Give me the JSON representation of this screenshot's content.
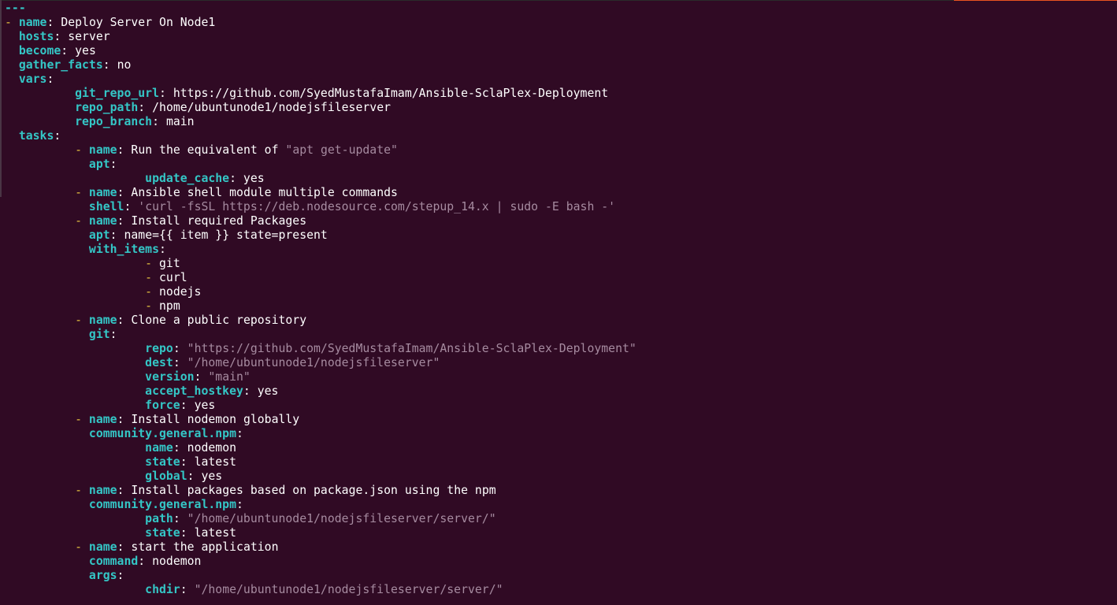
{
  "window": {
    "type": "terminal",
    "accent_color": "#e95420",
    "background_color": "#300a24"
  },
  "editor": {
    "language": "yaml",
    "lines": [
      {
        "indent": "",
        "dash": "",
        "key": "---",
        "value": "",
        "valueType": "doc"
      },
      {
        "indent": "",
        "dash": "- ",
        "key": "name",
        "value": "Deploy Server On Node1",
        "valueType": "plain"
      },
      {
        "indent": "  ",
        "dash": "",
        "key": "hosts",
        "value": "server",
        "valueType": "plain"
      },
      {
        "indent": "  ",
        "dash": "",
        "key": "become",
        "value": "yes",
        "valueType": "plain"
      },
      {
        "indent": "  ",
        "dash": "",
        "key": "gather_facts",
        "value": "no",
        "valueType": "plain"
      },
      {
        "indent": "  ",
        "dash": "",
        "key": "vars",
        "value": "",
        "valueType": "none"
      },
      {
        "indent": "          ",
        "dash": "",
        "key": "git_repo_url",
        "value": "https://github.com/SyedMustafaImam/Ansible-SclaPlex-Deployment",
        "valueType": "plain"
      },
      {
        "indent": "          ",
        "dash": "",
        "key": "repo_path",
        "value": "/home/ubuntunode1/nodejsfileserver",
        "valueType": "plain"
      },
      {
        "indent": "          ",
        "dash": "",
        "key": "repo_branch",
        "value": "main",
        "valueType": "plain"
      },
      {
        "indent": "  ",
        "dash": "",
        "key": "tasks",
        "value": "",
        "valueType": "none"
      },
      {
        "indent": "          ",
        "dash": "- ",
        "key": "name",
        "value": "Run the equivalent of ",
        "valueType": "mixed",
        "string": "\"apt get-update\""
      },
      {
        "indent": "            ",
        "dash": "",
        "key": "apt",
        "value": "",
        "valueType": "none"
      },
      {
        "indent": "                    ",
        "dash": "",
        "key": "update_cache",
        "value": "yes",
        "valueType": "plain"
      },
      {
        "indent": "          ",
        "dash": "- ",
        "key": "name",
        "value": "Ansible shell module multiple commands",
        "valueType": "plain"
      },
      {
        "indent": "            ",
        "dash": "",
        "key": "shell",
        "value": "'curl -fsSL https://deb.nodesource.com/stepup_14.x | sudo -E bash -'",
        "valueType": "string"
      },
      {
        "indent": "          ",
        "dash": "- ",
        "key": "name",
        "value": "Install required Packages",
        "valueType": "plain"
      },
      {
        "indent": "            ",
        "dash": "",
        "key": "apt",
        "value": "name={{ item }} state=present",
        "valueType": "plain"
      },
      {
        "indent": "            ",
        "dash": "",
        "key": "with_items",
        "value": "",
        "valueType": "none"
      },
      {
        "indent": "                    ",
        "dash": "- ",
        "key": "",
        "value": "git",
        "valueType": "item"
      },
      {
        "indent": "                    ",
        "dash": "- ",
        "key": "",
        "value": "curl",
        "valueType": "item"
      },
      {
        "indent": "                    ",
        "dash": "- ",
        "key": "",
        "value": "nodejs",
        "valueType": "item"
      },
      {
        "indent": "                    ",
        "dash": "- ",
        "key": "",
        "value": "npm",
        "valueType": "item"
      },
      {
        "indent": "          ",
        "dash": "- ",
        "key": "name",
        "value": "Clone a public repository",
        "valueType": "plain"
      },
      {
        "indent": "            ",
        "dash": "",
        "key": "git",
        "value": "",
        "valueType": "none"
      },
      {
        "indent": "                    ",
        "dash": "",
        "key": "repo",
        "value": "\"https://github.com/SyedMustafaImam/Ansible-SclaPlex-Deployment\"",
        "valueType": "string"
      },
      {
        "indent": "                    ",
        "dash": "",
        "key": "dest",
        "value": "\"/home/ubuntunode1/nodejsfileserver\"",
        "valueType": "string"
      },
      {
        "indent": "                    ",
        "dash": "",
        "key": "version",
        "value": "\"main\"",
        "valueType": "string"
      },
      {
        "indent": "                    ",
        "dash": "",
        "key": "accept_hostkey",
        "value": "yes",
        "valueType": "plain"
      },
      {
        "indent": "                    ",
        "dash": "",
        "key": "force",
        "value": "yes",
        "valueType": "plain"
      },
      {
        "indent": "          ",
        "dash": "- ",
        "key": "name",
        "value": "Install nodemon globally",
        "valueType": "plain"
      },
      {
        "indent": "            ",
        "dash": "",
        "key": "community.general.npm",
        "value": "",
        "valueType": "none"
      },
      {
        "indent": "                    ",
        "dash": "",
        "key": "name",
        "value": "nodemon",
        "valueType": "plain"
      },
      {
        "indent": "                    ",
        "dash": "",
        "key": "state",
        "value": "latest",
        "valueType": "plain"
      },
      {
        "indent": "                    ",
        "dash": "",
        "key": "global",
        "value": "yes",
        "valueType": "plain"
      },
      {
        "indent": "          ",
        "dash": "- ",
        "key": "name",
        "value": "Install packages based on package.json using the npm",
        "valueType": "plain"
      },
      {
        "indent": "            ",
        "dash": "",
        "key": "community.general.npm",
        "value": "",
        "valueType": "none"
      },
      {
        "indent": "                    ",
        "dash": "",
        "key": "path",
        "value": "\"/home/ubuntunode1/nodejsfileserver/server/\"",
        "valueType": "string"
      },
      {
        "indent": "                    ",
        "dash": "",
        "key": "state",
        "value": "latest",
        "valueType": "plain"
      },
      {
        "indent": "          ",
        "dash": "- ",
        "key": "name",
        "value": "start the application",
        "valueType": "plain"
      },
      {
        "indent": "            ",
        "dash": "",
        "key": "command",
        "value": "nodemon",
        "valueType": "plain"
      },
      {
        "indent": "            ",
        "dash": "",
        "key": "args",
        "value": "",
        "valueType": "none"
      },
      {
        "indent": "                    ",
        "dash": "",
        "key": "chdir",
        "value": "\"/home/ubuntunode1/nodejsfileserver/server/\"",
        "valueType": "string"
      }
    ]
  }
}
